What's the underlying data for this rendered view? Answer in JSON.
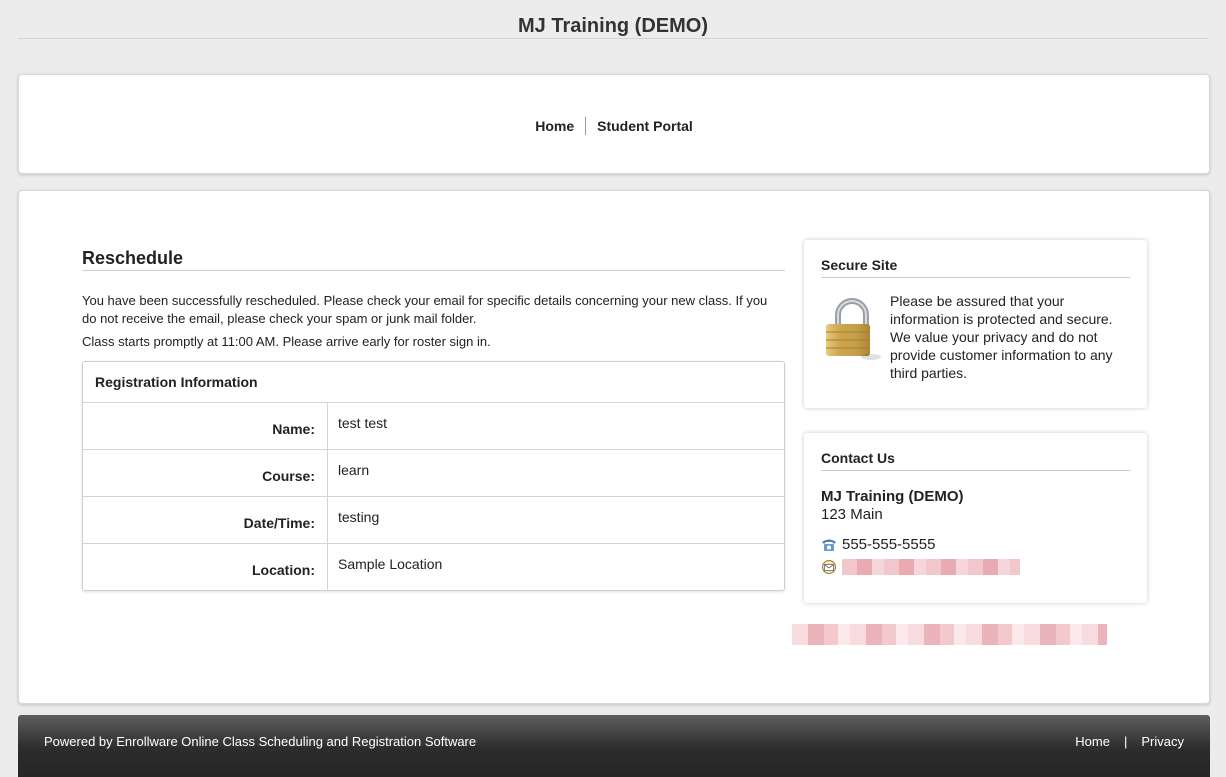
{
  "site": {
    "title": "MJ Training (DEMO)"
  },
  "nav": {
    "home": "Home",
    "student_portal": "Student Portal"
  },
  "main": {
    "heading": "Reschedule",
    "message_success": "You have been successfully rescheduled. Please check your email for specific details concerning your new class. If you do not receive the email, please check your spam or junk mail folder.",
    "message_start": "Class starts promptly at 11:00 AM. Please arrive early for roster sign in.",
    "registration": {
      "header": "Registration Information",
      "rows": [
        {
          "label": "Name:",
          "value": "test test"
        },
        {
          "label": "Course:",
          "value": "learn"
        },
        {
          "label": "Date/Time:",
          "value": "testing"
        },
        {
          "label": "Location:",
          "value": "Sample Location"
        }
      ]
    }
  },
  "sidebar": {
    "secure": {
      "title": "Secure Site",
      "text": "Please be assured that your information is protected and secure. We value your privacy and do not provide customer information to any third parties.",
      "icon": "padlock-icon"
    },
    "contact": {
      "title": "Contact Us",
      "org": "MJ Training (DEMO)",
      "address": "123 Main",
      "phone": "555-555-5555",
      "phone_icon": "phone-icon",
      "email_icon": "email-icon"
    }
  },
  "footer": {
    "powered_prefix": "Powered by ",
    "powered_link": "Enrollware Online Class Scheduling and Registration Software",
    "home": "Home",
    "separator": "|",
    "privacy": "Privacy"
  },
  "colors": {
    "footer_bg": "#2c2c2c",
    "panel_bg": "#ffffff",
    "page_bg": "#ececec",
    "gold": "#c9a24a"
  }
}
